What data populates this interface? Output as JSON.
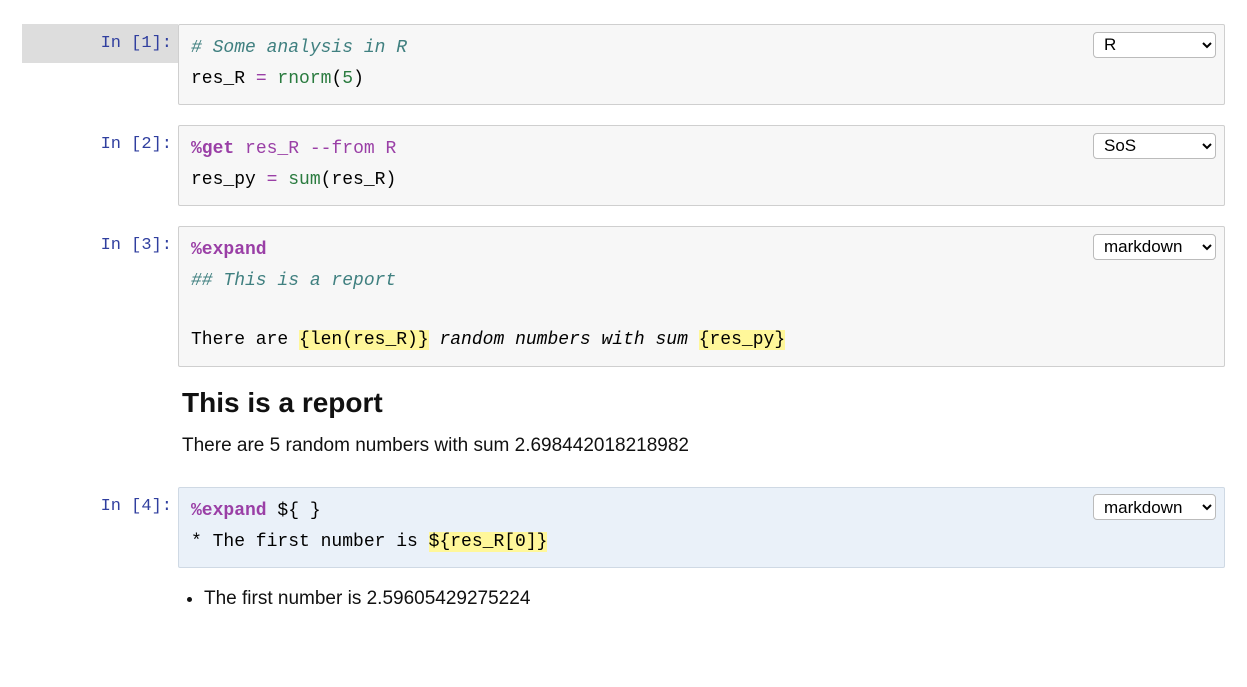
{
  "cells": [
    {
      "prompt_label": "In [1]:",
      "kernel": "R",
      "kernel_options": [
        "R",
        "SoS",
        "markdown"
      ],
      "selected": true,
      "code": {
        "l1_comment": "# Some analysis in R",
        "l2_a": "res_R ",
        "l2_op": "= ",
        "l2_func": "rnorm",
        "l2_paren_o": "(",
        "l2_num": "5",
        "l2_paren_c": ")"
      }
    },
    {
      "prompt_label": "In [2]:",
      "kernel": "SoS",
      "kernel_options": [
        "R",
        "SoS",
        "markdown"
      ],
      "code": {
        "l1_magic": "%get",
        "l1_sp1": " ",
        "l1_arg1": "res_R",
        "l1_sp2": " ",
        "l1_arg2": "--from R",
        "l2_a": "res_py ",
        "l2_op": "= ",
        "l2_func": "sum",
        "l2_paren_o": "(",
        "l2_var": "res_R",
        "l2_paren_c": ")"
      }
    },
    {
      "prompt_label": "In [3]:",
      "kernel": "markdown",
      "kernel_options": [
        "R",
        "SoS",
        "markdown"
      ],
      "code": {
        "l1_magic": "%expand",
        "l2_heading": "## This is a report",
        "l4_a": "There are ",
        "l4_hl1": "{len(res_R)}",
        "l4_b": " random numbers with sum ",
        "l4_hl2": "{res_py}"
      },
      "output": {
        "heading": "This is a report",
        "paragraph": "There are 5 random numbers with sum 2.698442018218982"
      }
    },
    {
      "prompt_label": "In [4]:",
      "kernel": "markdown",
      "kernel_options": [
        "R",
        "SoS",
        "markdown"
      ],
      "md_selected": true,
      "code": {
        "l1_magic": "%expand",
        "l1_rest": " ${ }",
        "l2_a": "* The first number is ",
        "l2_hl": "${res_R[0]}"
      },
      "output": {
        "bullet": "The first number is 2.59605429275224"
      }
    }
  ]
}
